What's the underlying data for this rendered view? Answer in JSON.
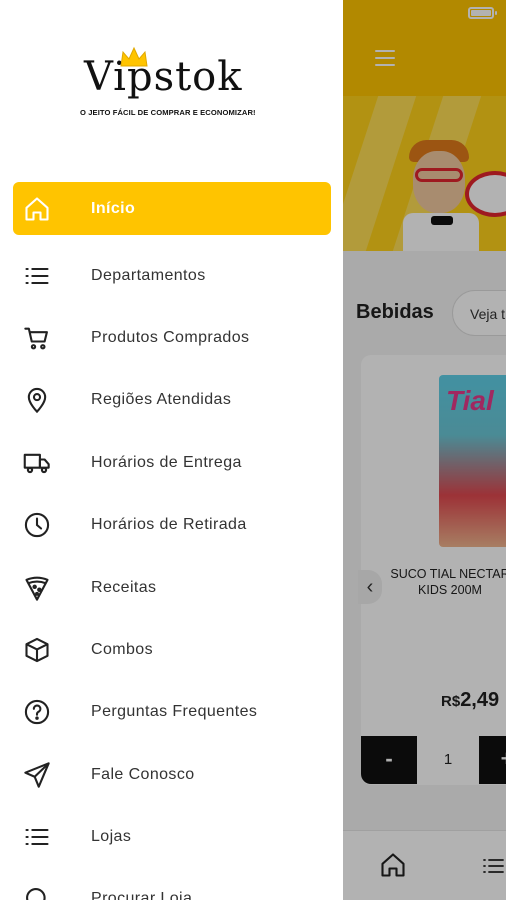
{
  "drawer": {
    "logo_text": "Vipstok",
    "tagline": "O JEITO FÁCIL DE COMPRAR E ECONOMIZAR!",
    "accent_color": "#ffc400",
    "items": [
      {
        "label": "Início",
        "icon": "home-icon",
        "active": true
      },
      {
        "label": "Departamentos",
        "icon": "list-icon"
      },
      {
        "label": "Produtos Comprados",
        "icon": "cart-icon"
      },
      {
        "label": "Regiões Atendidas",
        "icon": "location-pin-icon"
      },
      {
        "label": "Horários de Entrega",
        "icon": "truck-icon"
      },
      {
        "label": "Horários de Retirada",
        "icon": "clock-icon"
      },
      {
        "label": "Receitas",
        "icon": "pizza-icon"
      },
      {
        "label": "Combos",
        "icon": "box-icon"
      },
      {
        "label": "Perguntas Frequentes",
        "icon": "question-icon"
      },
      {
        "label": "Fale Conosco",
        "icon": "send-icon"
      },
      {
        "label": "Lojas",
        "icon": "list-icon"
      },
      {
        "label": "Procurar Loja",
        "icon": "search-icon"
      }
    ]
  },
  "background": {
    "section_title": "Bebidas",
    "see_all_label": "Veja t",
    "product": {
      "name_line1": "SUCO TIAL NECTAR",
      "name_line2": "KIDS 200M",
      "image_text": "Tial",
      "currency": "R$",
      "price": "2,49",
      "quantity": "1",
      "minus_label": "-",
      "plus_label": "+"
    }
  }
}
